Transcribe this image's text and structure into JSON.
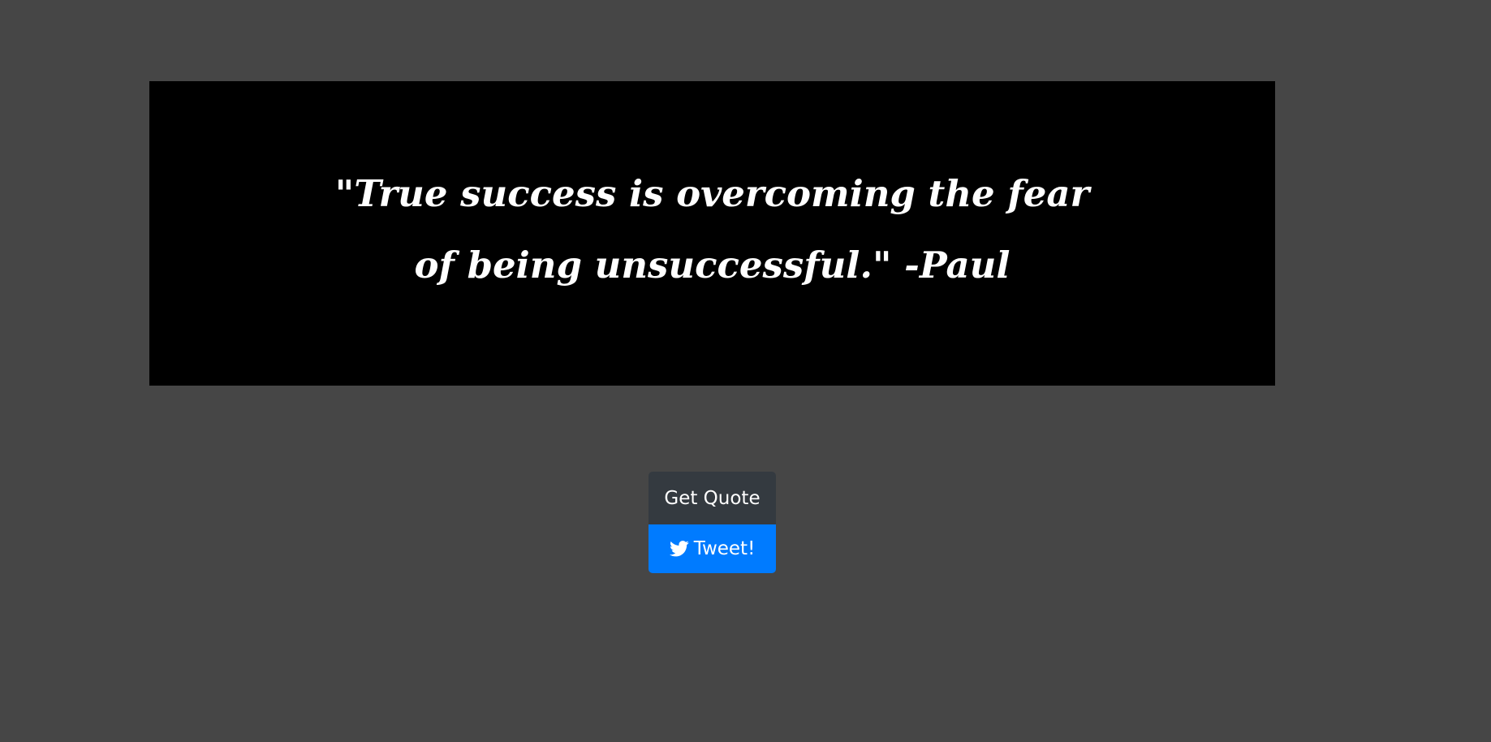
{
  "quote": {
    "text": "\"True success is overcoming the fear of being unsuccessful.\" -Paul"
  },
  "buttons": {
    "get_quote_label": "Get Quote",
    "tweet_label": "Tweet!"
  },
  "icons": {
    "tweet": "twitter-icon"
  },
  "colors": {
    "background": "#464646",
    "quote_box": "#000000",
    "quote_text": "#ffffff",
    "get_quote_button": "#343a40",
    "tweet_button": "#007bff"
  }
}
